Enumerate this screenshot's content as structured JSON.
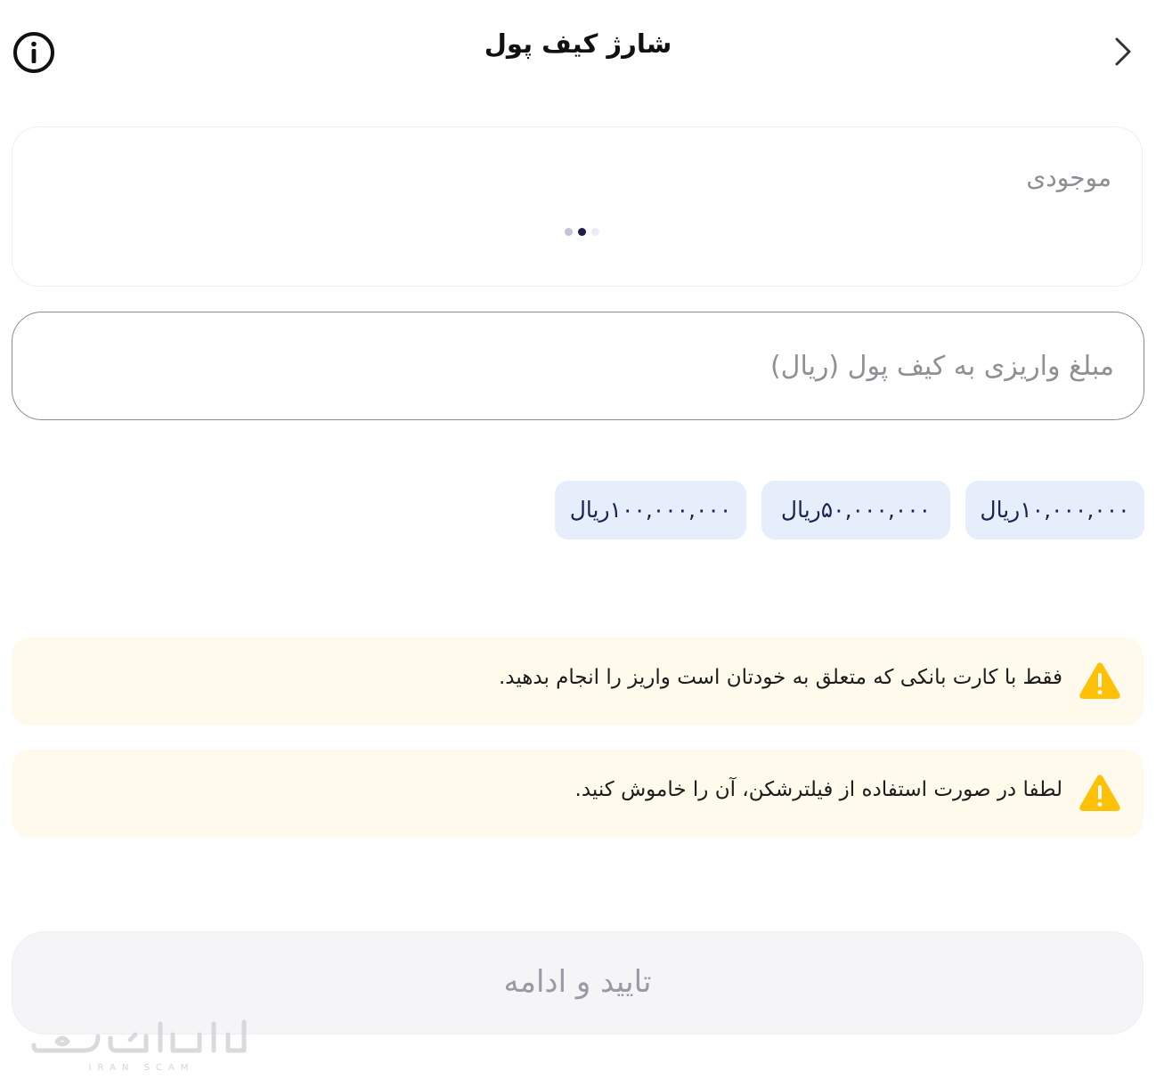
{
  "header": {
    "title": "شارژ کیف پول",
    "info_icon": "info-circle-icon",
    "back_icon": "chevron-right-icon"
  },
  "balance": {
    "label": "موجودی",
    "loading_icon": "loading-dots-icon"
  },
  "deposit_input": {
    "placeholder": "مبلغ واریزی به کیف پول (ریال)",
    "value": ""
  },
  "quick_amounts": [
    {
      "label": "۱۰,۰۰۰,۰۰۰ریال"
    },
    {
      "label": "۵۰,۰۰۰,۰۰۰ریال"
    },
    {
      "label": "۱۰۰,۰۰۰,۰۰۰ریال"
    }
  ],
  "warnings": [
    {
      "icon": "warning-triangle-icon",
      "text": "فقط با کارت بانکی که متعلق به خودتان است واریز را انجام بدهید."
    },
    {
      "icon": "warning-triangle-icon",
      "text": "لطفا در صورت استفاده از فیلترشکن، آن را خاموش کنید."
    }
  ],
  "submit": {
    "label": "تایید و ادامه",
    "enabled": false
  },
  "watermark": {
    "text": "ایران اسکم",
    "subtext": "IRAN SCAM"
  },
  "colors": {
    "chip_bg": "#e6edfb",
    "chip_text": "#1b2350",
    "warning_bg": "#fffaeb",
    "warning_icon": "#ffc107",
    "disabled_button_bg": "#f5f5f8",
    "disabled_button_text": "#9a9aa5"
  }
}
